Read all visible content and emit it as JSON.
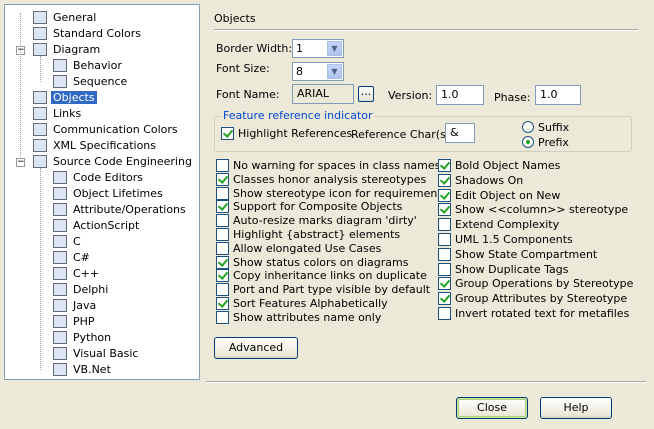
{
  "tree": {
    "items": [
      {
        "label": "General",
        "icon": "general-settings-icon"
      },
      {
        "label": "Standard Colors",
        "icon": "palette-icon"
      },
      {
        "label": "Diagram",
        "icon": "diagram-icon"
      },
      {
        "label": "Behavior",
        "icon": "behavior-icon"
      },
      {
        "label": "Sequence",
        "icon": "sequence-icon"
      },
      {
        "label": "Objects",
        "icon": "objects-icon"
      },
      {
        "label": "Links",
        "icon": "links-icon"
      },
      {
        "label": "Communication Colors",
        "icon": "communication-colors-icon"
      },
      {
        "label": "XML Specifications",
        "icon": "xml-icon"
      },
      {
        "label": "Source Code Engineering",
        "icon": "source-code-icon"
      },
      {
        "label": "Code Editors",
        "icon": "code-editors-icon"
      },
      {
        "label": "Object Lifetimes",
        "icon": "object-lifetimes-icon"
      },
      {
        "label": "Attribute/Operations",
        "icon": "attribute-operations-icon"
      },
      {
        "label": "ActionScript",
        "icon": "actionscript-icon"
      },
      {
        "label": "C",
        "icon": "c-language-icon"
      },
      {
        "label": "C#",
        "icon": "csharp-icon"
      },
      {
        "label": "C++",
        "icon": "cpp-icon"
      },
      {
        "label": "Delphi",
        "icon": "delphi-icon"
      },
      {
        "label": "Java",
        "icon": "java-icon"
      },
      {
        "label": "PHP",
        "icon": "php-icon"
      },
      {
        "label": "Python",
        "icon": "python-icon"
      },
      {
        "label": "Visual Basic",
        "icon": "visual-basic-icon"
      },
      {
        "label": "VB.Net",
        "icon": "vbnet-icon"
      }
    ],
    "selected": "Objects"
  },
  "panel": {
    "title": "Objects",
    "border_width_label": "Border Width:",
    "border_width_value": "1",
    "font_size_label": "Font Size:",
    "font_size_value": "8",
    "font_name_label": "Font Name:",
    "font_name_value": "ARIAL",
    "font_browse_label": "...",
    "version_label": "Version:",
    "version_value": "1.0",
    "phase_label": "Phase:",
    "phase_value": "1.0"
  },
  "feature_ref": {
    "legend": "Feature reference indicator",
    "highlight_label": "Highlight References",
    "highlight_checked": true,
    "ref_char_label": "Reference Char(s)",
    "ref_char_value": "&",
    "suffix_label": "Suffix",
    "prefix_label": "Prefix",
    "selected": "Prefix"
  },
  "options_left": [
    {
      "label": "No warning for spaces in class names",
      "checked": false
    },
    {
      "label": "Classes honor analysis stereotypes",
      "checked": true
    },
    {
      "label": "Show stereotype icon for requirements",
      "checked": false
    },
    {
      "label": "Support for Composite Objects",
      "checked": true
    },
    {
      "label": "Auto-resize marks diagram 'dirty'",
      "checked": false
    },
    {
      "label": "Highlight {abstract} elements",
      "checked": false
    },
    {
      "label": "Allow elongated Use Cases",
      "checked": false
    },
    {
      "label": "Show status colors on diagrams",
      "checked": true
    },
    {
      "label": "Copy inheritance links on duplicate",
      "checked": true
    },
    {
      "label": "Port and Part type visible by default",
      "checked": false
    },
    {
      "label": "Sort Features Alphabetically",
      "checked": true
    },
    {
      "label": "Show attributes name only",
      "checked": false
    }
  ],
  "options_right": [
    {
      "label": "Bold Object Names",
      "checked": true
    },
    {
      "label": "Shadows On",
      "checked": true
    },
    {
      "label": "Edit Object on New",
      "checked": true
    },
    {
      "label": "Show <<column>> stereotype",
      "checked": true
    },
    {
      "label": "Extend Complexity",
      "checked": false
    },
    {
      "label": "UML 1.5 Components",
      "checked": false
    },
    {
      "label": "Show State Compartment",
      "checked": false
    },
    {
      "label": "Show Duplicate Tags",
      "checked": false
    },
    {
      "label": "Group Operations by Stereotype",
      "checked": true
    },
    {
      "label": "Group Attributes by Stereotype",
      "checked": true
    },
    {
      "label": "Invert rotated text for metafiles",
      "checked": false
    }
  ],
  "buttons": {
    "advanced": "Advanced",
    "close": "Close",
    "help": "Help"
  },
  "colors": {
    "dialog_bg": "#ece9d8",
    "selection": "#316ac5",
    "check_mark": "#21a121",
    "group_legend": "#0046d5"
  }
}
